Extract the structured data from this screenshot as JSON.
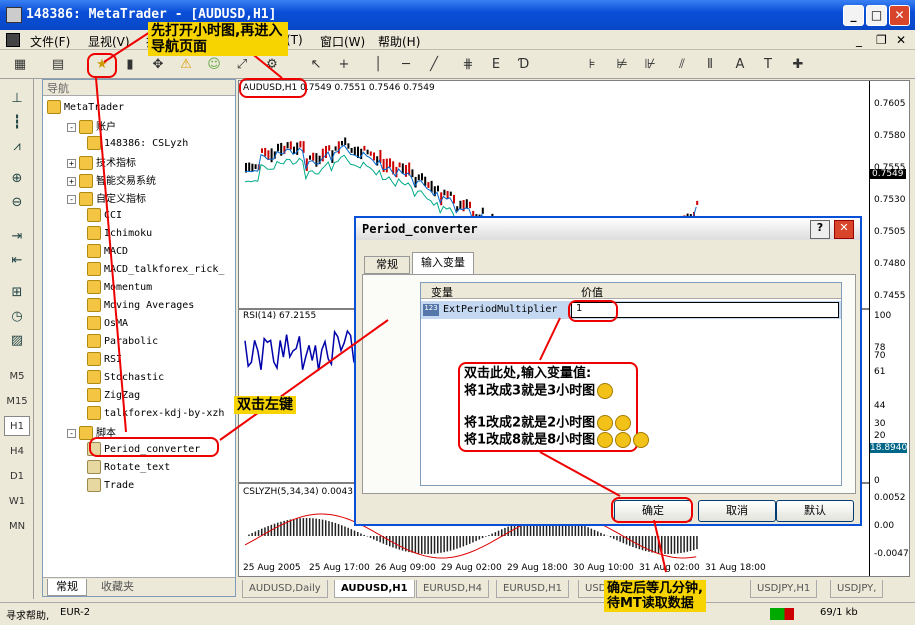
{
  "window": {
    "title": "148386: MetaTrader - [AUDUSD,H1]",
    "buttons": [
      "_",
      "□",
      "✕"
    ]
  },
  "menu": [
    "文件(F)",
    "显视(V)",
    "插",
    "(T)",
    "窗口(W)",
    "帮助(H)"
  ],
  "mdi_buttons": [
    "_",
    "❐",
    "✕"
  ],
  "navigator": {
    "header": "导航",
    "items": [
      {
        "label": "MetaTrader",
        "level": 0,
        "icon": "metatrader-icon"
      },
      {
        "label": "账户",
        "level": 1,
        "icon": "accounts-icon",
        "expander": "-"
      },
      {
        "label": "148386: CSLyzh",
        "level": 2,
        "icon": "account-icon"
      },
      {
        "label": "技术指标",
        "level": 1,
        "icon": "indicator-folder-icon",
        "expander": "+"
      },
      {
        "label": "智能交易系统",
        "level": 1,
        "icon": "expert-folder-icon",
        "expander": "+"
      },
      {
        "label": "自定义指标",
        "level": 1,
        "icon": "custom-folder-icon",
        "expander": "-"
      },
      {
        "label": "CCI",
        "level": 2,
        "icon": "indicator-icon"
      },
      {
        "label": "Ichimoku",
        "level": 2,
        "icon": "indicator-icon"
      },
      {
        "label": "MACD",
        "level": 2,
        "icon": "indicator-icon"
      },
      {
        "label": "MACD_talkforex_rick_",
        "level": 2,
        "icon": "indicator-icon"
      },
      {
        "label": "Momentum",
        "level": 2,
        "icon": "indicator-icon"
      },
      {
        "label": "Moving Averages",
        "level": 2,
        "icon": "indicator-icon"
      },
      {
        "label": "OsMA",
        "level": 2,
        "icon": "indicator-icon"
      },
      {
        "label": "Parabolic",
        "level": 2,
        "icon": "indicator-icon"
      },
      {
        "label": "RSI",
        "level": 2,
        "icon": "indicator-icon"
      },
      {
        "label": "Stochastic",
        "level": 2,
        "icon": "indicator-icon"
      },
      {
        "label": "ZigZag",
        "level": 2,
        "icon": "indicator-icon"
      },
      {
        "label": "talkforex-kdj-by-xzh",
        "level": 2,
        "icon": "indicator-icon"
      },
      {
        "label": "脚本",
        "level": 1,
        "icon": "scripts-folder-icon",
        "expander": "-"
      },
      {
        "label": "Period_converter",
        "level": 2,
        "icon": "script-icon"
      },
      {
        "label": "Rotate_text",
        "level": 2,
        "icon": "script-icon"
      },
      {
        "label": "Trade",
        "level": 2,
        "icon": "script-icon"
      }
    ],
    "tabs": [
      "常规",
      "收藏夹"
    ]
  },
  "timeframes": [
    "M5",
    "M15",
    "H1",
    "H4",
    "D1",
    "W1",
    "MN"
  ],
  "timeframe_selected": "H1",
  "chart": {
    "header": "AUDUSD,H1",
    "header_values": "0.7549 0.7551 0.7546 0.7549",
    "price_ticks": [
      "0.7605",
      "0.7580",
      "0.7555",
      "0.7530",
      "0.7505",
      "0.7480",
      "0.7455"
    ],
    "current_price": "0.7549",
    "rsi_label": "RSI(14) 67.2155",
    "rsi_ticks": [
      "100",
      "78",
      "70",
      "61",
      "44",
      "30",
      "20",
      "0"
    ],
    "rsi_value": "18.8940",
    "macd_label": "CSLYZH(5,34,34) 0.0043 C",
    "macd_ticks": [
      "0.0052",
      "0.00",
      "-0.0047"
    ],
    "time_ticks": [
      "25 Aug 2005",
      "25 Aug 17:00",
      "26 Aug 09:00",
      "29 Aug 02:00",
      "29 Aug 18:00",
      "30 Aug 10:00",
      "31 Aug 02:00",
      "31 Aug 18:00"
    ]
  },
  "chart_tabs": [
    "AUDUSD,Daily",
    "AUDUSD,H1",
    "EURUSD,H4",
    "EURUSD,H1",
    "USD",
    "USDJPY,H1",
    "USDJPY,"
  ],
  "chart_tab_selected": "AUDUSD,H1",
  "status": {
    "help": "寻求帮助,",
    "profile": "EUR-2",
    "conn": "69/1 kb"
  },
  "dialog": {
    "title": "Period_converter",
    "tabs": [
      "常规",
      "输入变量"
    ],
    "active_tab": "输入变量",
    "col_variable": "变量",
    "col_value": "价值",
    "param_name": "ExtPeriodMultiplier",
    "param_value": "1",
    "ok": "确定",
    "cancel": "取消",
    "reset": "默认"
  },
  "annotations": {
    "top": "先打开小时图,再进入导航页面",
    "dbl": "双击左键",
    "edit1": "双击此处,输入变量值:",
    "edit2": "将1改成3就是3小时图",
    "edit3": "将1改成2就是2小时图",
    "edit4": "将1改成8就是8小时图",
    "wait1": "确定后等几分钟,",
    "wait2": "待MT读取数据"
  },
  "colors": {
    "title_blue": "#0a4fd8",
    "annotation_red": "#e00000",
    "note_yellow": "#f7d400"
  }
}
